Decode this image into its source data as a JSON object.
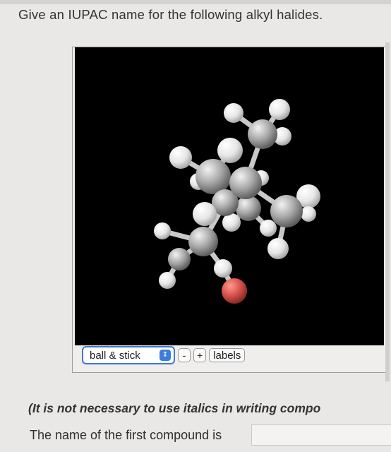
{
  "question": {
    "text": "Give an IUPAC name for the following alkyl halides."
  },
  "viewer": {
    "render_mode": "ball & stick",
    "zoom_out_label": "-",
    "zoom_in_label": "+",
    "labels_button": "labels",
    "colors": {
      "background": "#000000",
      "carbon": "#a9a9a9",
      "hydrogen": "#eeeeee",
      "halogen": "#d9534f"
    }
  },
  "note": {
    "text": "(It is not necessary to use italics in writing compo"
  },
  "answer": {
    "prompt": "The name of the first compound is",
    "value": ""
  }
}
